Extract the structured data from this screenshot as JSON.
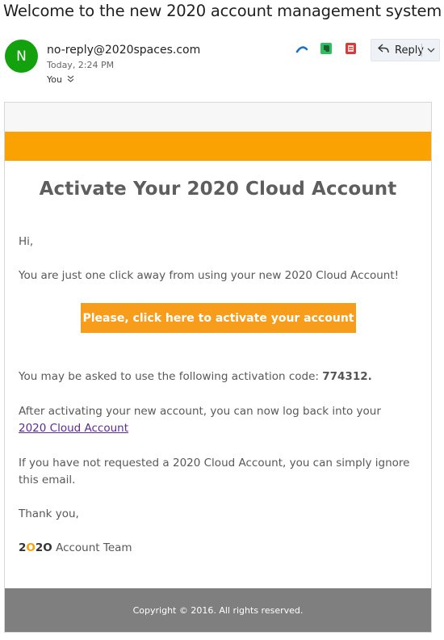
{
  "email": {
    "subject": "Welcome to the new 2020 account management system!",
    "avatar_initial": "N",
    "sender": "no-reply@2020spaces.com",
    "timestamp": "Today, 2:24 PM",
    "recipient": "You"
  },
  "actions": {
    "icons": [
      "collapse-arrow-icon",
      "evernote-icon",
      "pdf-icon"
    ],
    "reply_label": "Reply"
  },
  "message": {
    "heading": "Activate Your 2020 Cloud Account",
    "greeting": "Hi,",
    "intro": "You are just one click away from using your new 2020 Cloud Account!",
    "cta_label": "Please, click here to activate your account",
    "code_prefix": "You may be asked to use the following activation code: ",
    "code": "774312.",
    "after_prefix": "After activating your new account, you can now log back into your ",
    "after_link": "2020 Cloud Account",
    "ignore": "If you have not requested a 2020 Cloud Account, you can simply ignore this email.",
    "thanks": "Thank you,",
    "team_brand_a": "2",
    "team_brand_b": "O",
    "team_brand_c": "2",
    "team_brand_d": "O",
    "team_suffix": " Account Team",
    "footer": "Copyright © 2016. All rights reserved."
  },
  "colors": {
    "accent_orange": "#f9a202",
    "button_orange": "#f79c1b",
    "avatar_green": "#13a10e",
    "link_purple": "#5a2c91",
    "footer_gray": "#7f7f7f"
  }
}
